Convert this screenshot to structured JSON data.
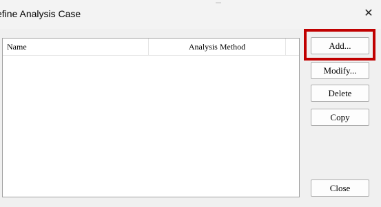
{
  "window": {
    "title": "efine Analysis Case",
    "close_glyph": "✕"
  },
  "list": {
    "columns": [
      "Name",
      "Analysis Method"
    ],
    "rows": []
  },
  "buttons": {
    "add": "Add...",
    "modify": "Modify...",
    "delete": "Delete",
    "copy": "Copy",
    "close": "Close"
  },
  "highlight": {
    "target": "add",
    "color": "#c00000"
  }
}
